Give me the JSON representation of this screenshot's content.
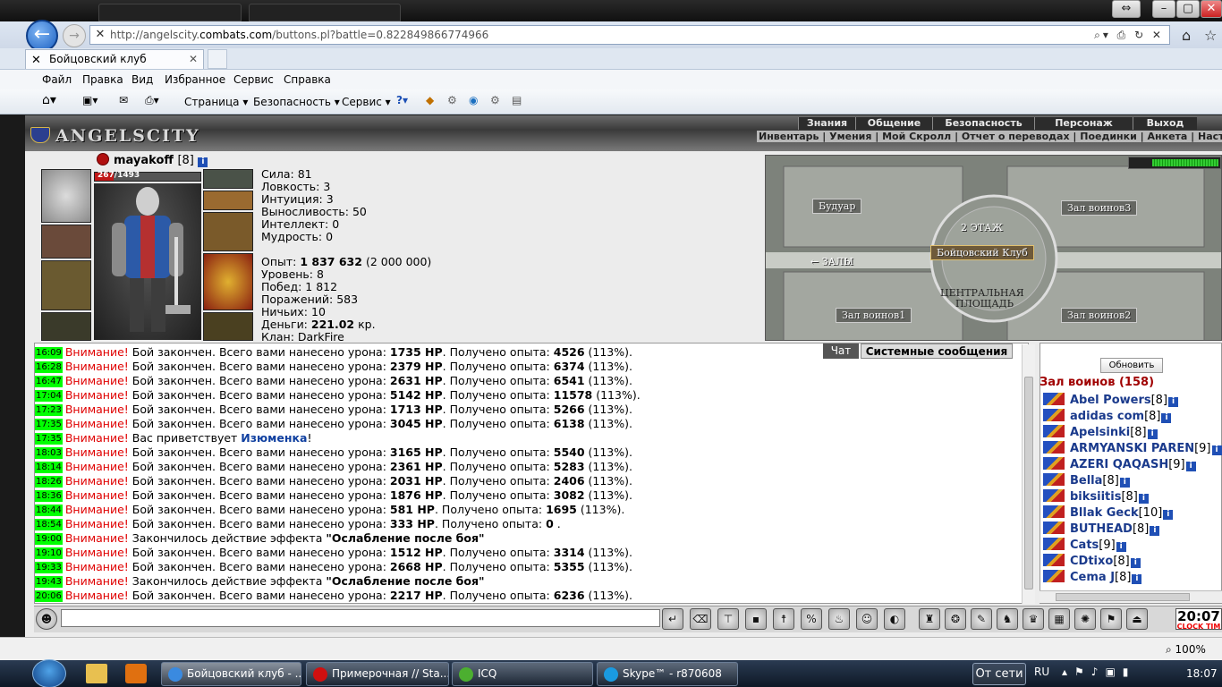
{
  "browser": {
    "url_prefix": "http://angelscity.",
    "url_host": "combats.com",
    "url_path": "/buttons.pl?battle=0.822849866774966",
    "tab_title": "Бойцовский клуб",
    "menu": [
      "Файл",
      "Правка",
      "Вид",
      "Избранное",
      "Сервис",
      "Справка"
    ],
    "commands": [
      "Страница",
      "Безопасность",
      "Сервис"
    ],
    "zoom": "100%"
  },
  "game": {
    "logo": "ANGELSCITY",
    "nav_top": [
      "Знания",
      "Общение",
      "Безопасность",
      "Персонаж",
      "Выход"
    ],
    "nav_bottom": "Инвентарь | Умения | Мой Скролл | Отчет о переводах | Поединки | Анкета | Настройки",
    "character": {
      "name": "mayakoff",
      "level": "[8]",
      "hp": "267/1493",
      "hp_fraction": 0.179,
      "stats": [
        {
          "label": "Сила:",
          "value": "81"
        },
        {
          "label": "Ловкость:",
          "value": "3"
        },
        {
          "label": "Интуиция:",
          "value": "3"
        },
        {
          "label": "Выносливость:",
          "value": "50"
        },
        {
          "label": "Интеллект:",
          "value": "0"
        },
        {
          "label": "Мудрость:",
          "value": "0"
        }
      ],
      "experience_label": "Опыт:",
      "experience": "1 837 632",
      "experience_next": "(2 000 000)",
      "level_label": "Уровень:",
      "level_value": "8",
      "wins_label": "Побед:",
      "wins": "1 812",
      "losses_label": "Поражений:",
      "losses": "583",
      "draws_label": "Ничьих:",
      "draws": "10",
      "money_label": "Деньги:",
      "money": "221.02",
      "money_unit": "кр.",
      "clan": "Клан: DarkFire"
    },
    "map": {
      "rooms": {
        "boudoir": "Будуар",
        "hall3": "Зал воинов3",
        "halls": "ЗАЛЫ",
        "hall1": "Зал воинов1",
        "hall2": "Зал воинов2",
        "club": "Бойцовский Клуб"
      },
      "floor": "2 ЭТАЖ",
      "square_1": "ЦЕНТРАЛЬНАЯ",
      "square_2": "ПЛОЩАДЬ"
    },
    "chat_tabs": {
      "chat": "Чат",
      "system": "Системные сообщения"
    },
    "chat": {
      "warn": "Внимание!",
      "battle_end": "Бой закончен. Всего вами нанесено урона:",
      "received": ". Получено опыта:",
      "greeting": "Вас приветствует",
      "greeting_nick": "Изюменка",
      "effect_end": "Закончилось действие эффекта",
      "effect_name": "\"Ослабление после боя\"",
      "hp_unit": "HP",
      "lines": [
        {
          "time": "16:09",
          "kind": "battle",
          "hp": "1735",
          "exp": "4526",
          "pct": "(113%)."
        },
        {
          "time": "16:28",
          "kind": "battle",
          "hp": "2379",
          "exp": "6374",
          "pct": "(113%)."
        },
        {
          "time": "16:47",
          "kind": "battle",
          "hp": "2631",
          "exp": "6541",
          "pct": "(113%)."
        },
        {
          "time": "17:04",
          "kind": "battle",
          "hp": "5142",
          "exp": "11578",
          "pct": "(113%)."
        },
        {
          "time": "17:23",
          "kind": "battle",
          "hp": "1713",
          "exp": "5266",
          "pct": "(113%)."
        },
        {
          "time": "17:35",
          "kind": "battle",
          "hp": "3045",
          "exp": "6138",
          "pct": "(113%)."
        },
        {
          "time": "17:35",
          "kind": "greet"
        },
        {
          "time": "18:03",
          "kind": "battle",
          "hp": "3165",
          "exp": "5540",
          "pct": "(113%)."
        },
        {
          "time": "18:14",
          "kind": "battle",
          "hp": "2361",
          "exp": "5283",
          "pct": "(113%)."
        },
        {
          "time": "18:26",
          "kind": "battle",
          "hp": "2031",
          "exp": "2406",
          "pct": "(113%)."
        },
        {
          "time": "18:36",
          "kind": "battle",
          "hp": "1876",
          "exp": "3082",
          "pct": "(113%)."
        },
        {
          "time": "18:44",
          "kind": "battle",
          "hp": "581",
          "exp": "1695",
          "pct": "(113%)."
        },
        {
          "time": "18:54",
          "kind": "battle",
          "hp": "333",
          "exp": "0",
          "pct": "."
        },
        {
          "time": "19:00",
          "kind": "effect"
        },
        {
          "time": "19:10",
          "kind": "battle",
          "hp": "1512",
          "exp": "3314",
          "pct": "(113%)."
        },
        {
          "time": "19:33",
          "kind": "battle",
          "hp": "2668",
          "exp": "5355",
          "pct": "(113%)."
        },
        {
          "time": "19:43",
          "kind": "effect"
        },
        {
          "time": "20:06",
          "kind": "battle",
          "hp": "2217",
          "exp": "6236",
          "pct": "(113%)."
        }
      ]
    },
    "users": {
      "refresh": "Обновить",
      "room": "Зал воинов (158)",
      "list": [
        {
          "name": "Abel Powers",
          "level": "[8]"
        },
        {
          "name": "adidas com",
          "level": "[8]"
        },
        {
          "name": "Apelsinki",
          "level": "[8]"
        },
        {
          "name": "ARMYANSKI PAREN",
          "level": "[9]"
        },
        {
          "name": "AZERI QAQASH",
          "level": "[9]"
        },
        {
          "name": "Bella",
          "level": "[8]"
        },
        {
          "name": "biksiitis",
          "level": "[8]"
        },
        {
          "name": "Bllak Geck",
          "level": "[10]"
        },
        {
          "name": "BUTHEAD",
          "level": "[8]"
        },
        {
          "name": "Cats",
          "level": "[9]"
        },
        {
          "name": "CDtixo",
          "level": "[8]"
        },
        {
          "name": "Cema J",
          "level": "[8]"
        }
      ]
    },
    "clock": {
      "time": "20:07",
      "label": "CLOCK",
      "label2": "TIM"
    }
  },
  "taskbar": {
    "tasks": [
      "Бойцовский клуб - ...",
      "Примерочная // Sta...",
      "ICQ",
      "Skype™ - r870608"
    ],
    "network": "От сети",
    "lang": "RU",
    "time": "18:07"
  }
}
